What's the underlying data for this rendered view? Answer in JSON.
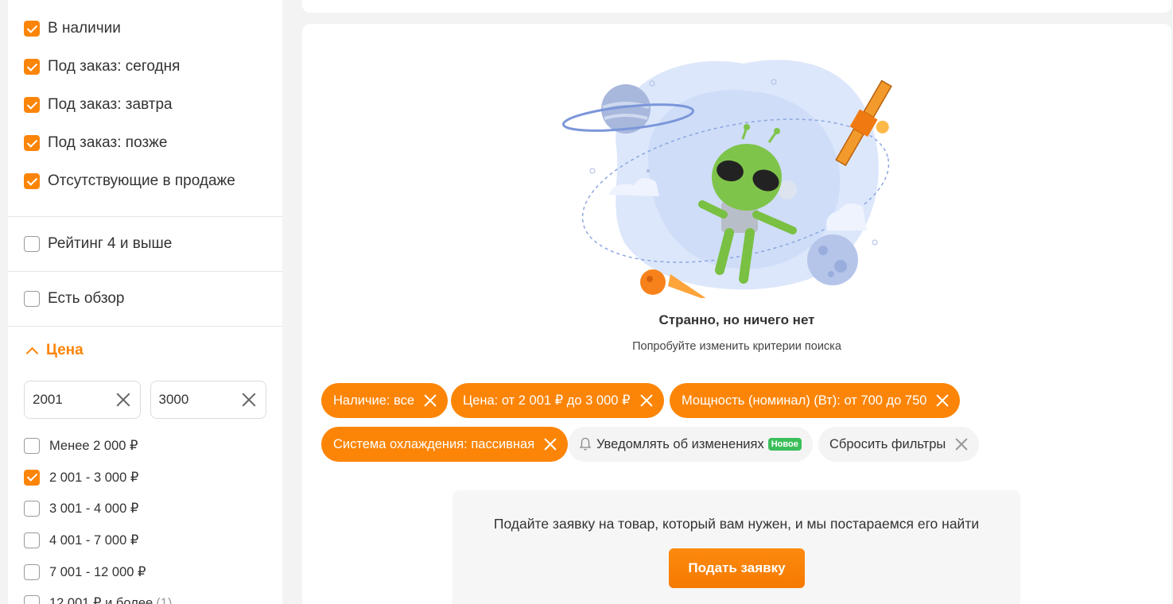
{
  "sidebar": {
    "availability": [
      {
        "label": "В наличии",
        "checked": true
      },
      {
        "label": "Под заказ: сегодня",
        "checked": true
      },
      {
        "label": "Под заказ: завтра",
        "checked": true
      },
      {
        "label": "Под заказ: позже",
        "checked": true
      },
      {
        "label": "Отсутствующие в продаже",
        "checked": true
      }
    ],
    "rating": {
      "label": "Рейтинг 4 и выше",
      "checked": false
    },
    "review": {
      "label": "Есть обзор",
      "checked": false
    },
    "price": {
      "title": "Цена",
      "from_value": "2001",
      "to_value": "3000",
      "ranges": [
        {
          "label": "Менее 2 000 ₽",
          "checked": false,
          "count": ""
        },
        {
          "label": "2 001 - 3 000 ₽",
          "checked": true,
          "count": ""
        },
        {
          "label": "3 001 - 4 000 ₽",
          "checked": false,
          "count": ""
        },
        {
          "label": "4 001 - 7 000 ₽",
          "checked": false,
          "count": ""
        },
        {
          "label": "7 001 - 12 000 ₽",
          "checked": false,
          "count": ""
        },
        {
          "label": "12 001 ₽ и более",
          "checked": false,
          "count": "(1)"
        }
      ]
    }
  },
  "empty": {
    "title": "Странно, но ничего нет",
    "subtitle": "Попробуйте изменить критерии поиска"
  },
  "chips": {
    "availability": "Наличие: все",
    "price": "Цена: от 2 001 ₽ до 3 000 ₽",
    "power": "Мощность (номинал) (Вт): от 700 до 750",
    "cooling": "Система охлаждения: пассивная",
    "notify": "Уведомлять об изменениях",
    "notify_badge": "Новое",
    "reset": "Сбросить фильтры"
  },
  "request": {
    "text": "Подайте заявку на товар, который вам нужен, и мы постараемся его найти",
    "button": "Подать заявку"
  },
  "colors": {
    "accent": "#fc8507",
    "badge": "#3cbf5b"
  }
}
